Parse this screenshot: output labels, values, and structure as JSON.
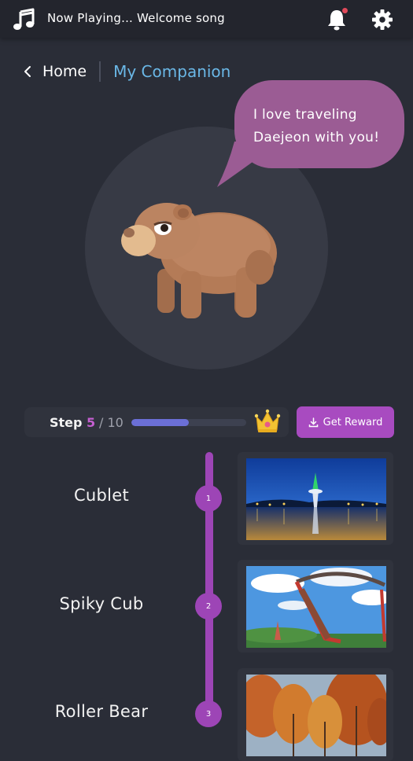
{
  "topbar": {
    "now_playing": "Now Playing... Welcome song",
    "has_notification": true
  },
  "breadcrumb": {
    "home": "Home",
    "current": "My Companion"
  },
  "companion": {
    "speech": "I love traveling Daejeon with you!",
    "speech_line1": "I love traveling",
    "speech_line2": "Daejeon with you!"
  },
  "progress": {
    "label": "Step",
    "current": "5",
    "total": "/ 10",
    "fraction": 0.5,
    "reward_button": "Get Reward"
  },
  "stages": [
    {
      "number": "1",
      "name": "Cublet",
      "image": "tower-night-plaza"
    },
    {
      "number": "2",
      "name": "Spiky Cub",
      "image": "amusement-swing-ride"
    },
    {
      "number": "3",
      "name": "Roller Bear",
      "image": "autumn-forest"
    }
  ],
  "colors": {
    "background": "#2a2d37",
    "accent_purple": "#a84bc0",
    "link_blue": "#6ab7e6",
    "bubble": "#9b5c94",
    "progress_fill": "#6b6fd6"
  }
}
